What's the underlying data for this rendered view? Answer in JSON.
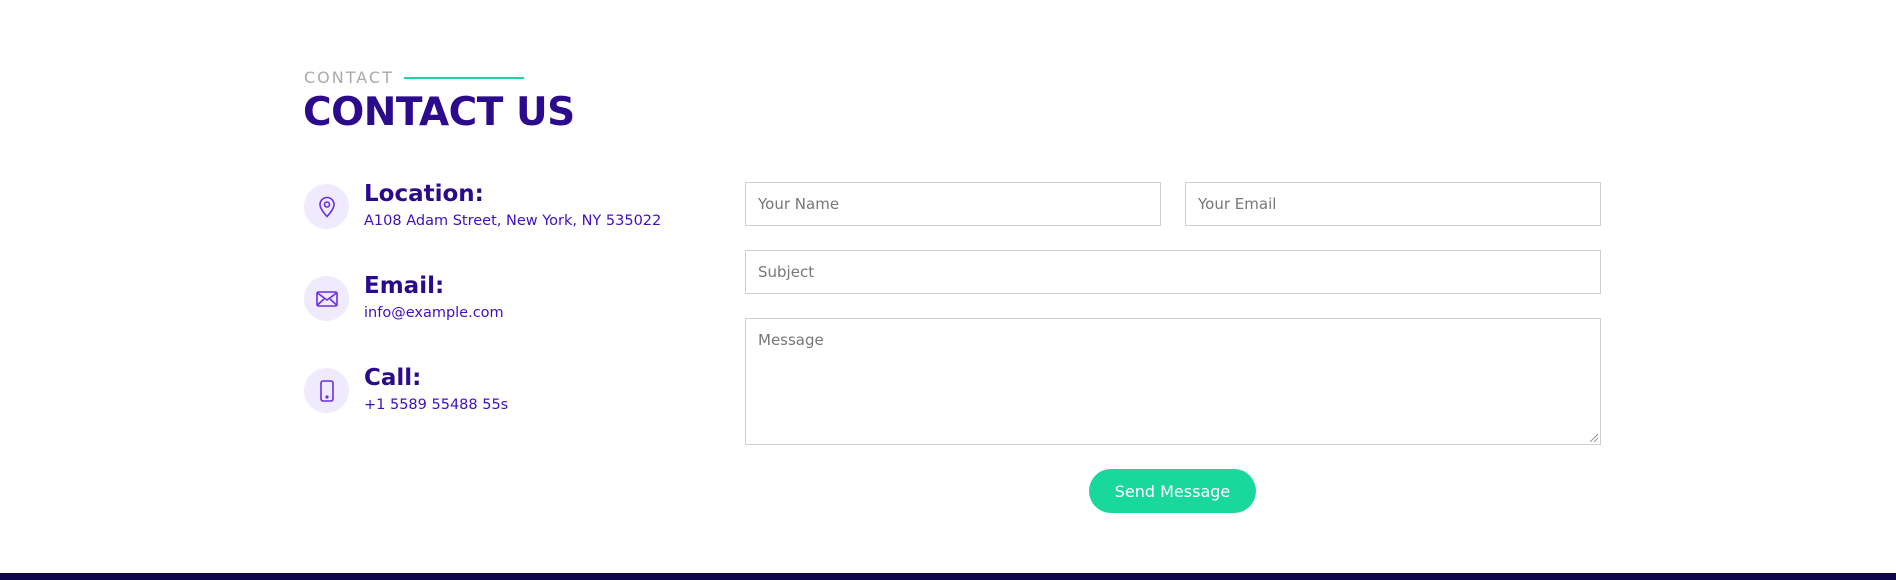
{
  "header": {
    "kicker": "CONTACT",
    "title": "CONTACT US"
  },
  "info": [
    {
      "icon": "map-pin-icon",
      "heading": "Location:",
      "value": "A108 Adam Street, New York, NY 535022"
    },
    {
      "icon": "envelope-icon",
      "heading": "Email:",
      "value": "info@example.com"
    },
    {
      "icon": "phone-icon",
      "heading": "Call:",
      "value": "+1 5589 55488 55s"
    }
  ],
  "form": {
    "name_placeholder": "Your Name",
    "email_placeholder": "Your Email",
    "subject_placeholder": "Subject",
    "message_placeholder": "Message",
    "send_label": "Send Message"
  },
  "colors": {
    "accent": "#19d89c",
    "heading": "#2b0a8c",
    "link": "#3f0fc1",
    "icon_bg": "#efeafd",
    "footer": "#10064a"
  }
}
